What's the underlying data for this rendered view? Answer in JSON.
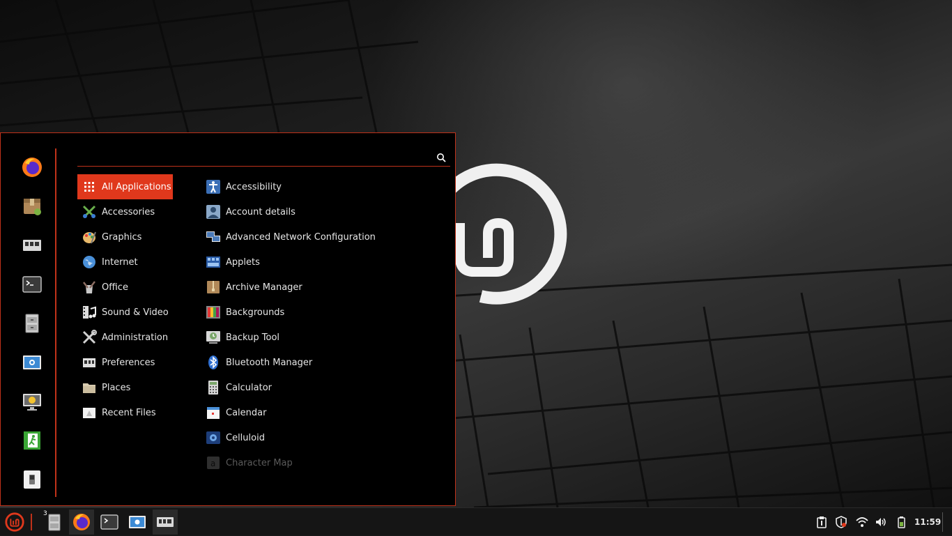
{
  "menu": {
    "search": {
      "value": "",
      "placeholder": ""
    },
    "favorites": [
      {
        "name": "firefox-icon"
      },
      {
        "name": "package-manager-icon"
      },
      {
        "name": "system-settings-icon"
      },
      {
        "name": "terminal-icon"
      },
      {
        "name": "file-manager-icon"
      },
      {
        "name": "screenshot-icon"
      },
      {
        "name": "lock-screen-icon"
      },
      {
        "name": "logout-icon"
      },
      {
        "name": "shutdown-icon"
      }
    ],
    "categories": [
      {
        "label": "All Applications",
        "icon": "grid-icon",
        "active": true
      },
      {
        "label": "Accessories",
        "icon": "accessories-icon"
      },
      {
        "label": "Graphics",
        "icon": "graphics-icon"
      },
      {
        "label": "Internet",
        "icon": "internet-icon"
      },
      {
        "label": "Office",
        "icon": "office-icon"
      },
      {
        "label": "Sound & Video",
        "icon": "sound-video-icon"
      },
      {
        "label": "Administration",
        "icon": "administration-icon"
      },
      {
        "label": "Preferences",
        "icon": "preferences-icon"
      },
      {
        "label": "Places",
        "icon": "places-icon"
      },
      {
        "label": "Recent Files",
        "icon": "recent-files-icon"
      }
    ],
    "apps": [
      {
        "label": "Accessibility",
        "icon": "accessibility-icon"
      },
      {
        "label": "Account details",
        "icon": "account-details-icon"
      },
      {
        "label": "Advanced Network Configuration",
        "icon": "network-config-icon"
      },
      {
        "label": "Applets",
        "icon": "applets-icon"
      },
      {
        "label": "Archive Manager",
        "icon": "archive-manager-icon"
      },
      {
        "label": "Backgrounds",
        "icon": "backgrounds-icon"
      },
      {
        "label": "Backup Tool",
        "icon": "backup-tool-icon"
      },
      {
        "label": "Bluetooth Manager",
        "icon": "bluetooth-icon"
      },
      {
        "label": "Calculator",
        "icon": "calculator-icon"
      },
      {
        "label": "Calendar",
        "icon": "calendar-icon"
      },
      {
        "label": "Celluloid",
        "icon": "celluloid-icon"
      },
      {
        "label": "Character Map",
        "icon": "character-map-icon",
        "faded": true
      }
    ]
  },
  "taskbar": {
    "file_manager_badge": "3",
    "clock": "11:59",
    "tray": [
      "clipboard-icon",
      "shield-icon",
      "wifi-icon",
      "volume-icon",
      "battery-icon"
    ]
  },
  "colors": {
    "accent": "#e0381c",
    "border": "#c0321a",
    "menu_bg": "#000000"
  }
}
